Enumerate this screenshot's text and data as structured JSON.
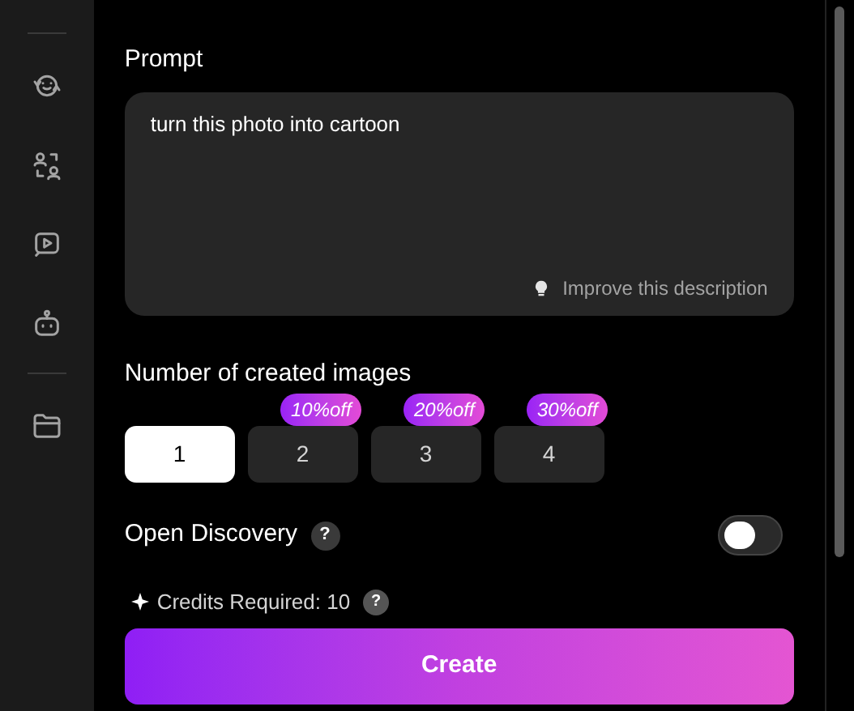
{
  "prompt": {
    "label": "Prompt",
    "value": "turn this photo into cartoon",
    "improve_link": "Improve this description"
  },
  "image_count": {
    "label": "Number of created images",
    "options": [
      {
        "label": "1",
        "selected": true
      },
      {
        "label": "2",
        "selected": false,
        "badge": "10%off"
      },
      {
        "label": "3",
        "selected": false,
        "badge": "20%off"
      },
      {
        "label": "4",
        "selected": false,
        "badge": "30%off"
      }
    ]
  },
  "open_discovery": {
    "label": "Open Discovery",
    "help": "?",
    "on": false
  },
  "credits": {
    "text": "Credits Required: 10",
    "help": "?"
  },
  "create_button": "Create"
}
